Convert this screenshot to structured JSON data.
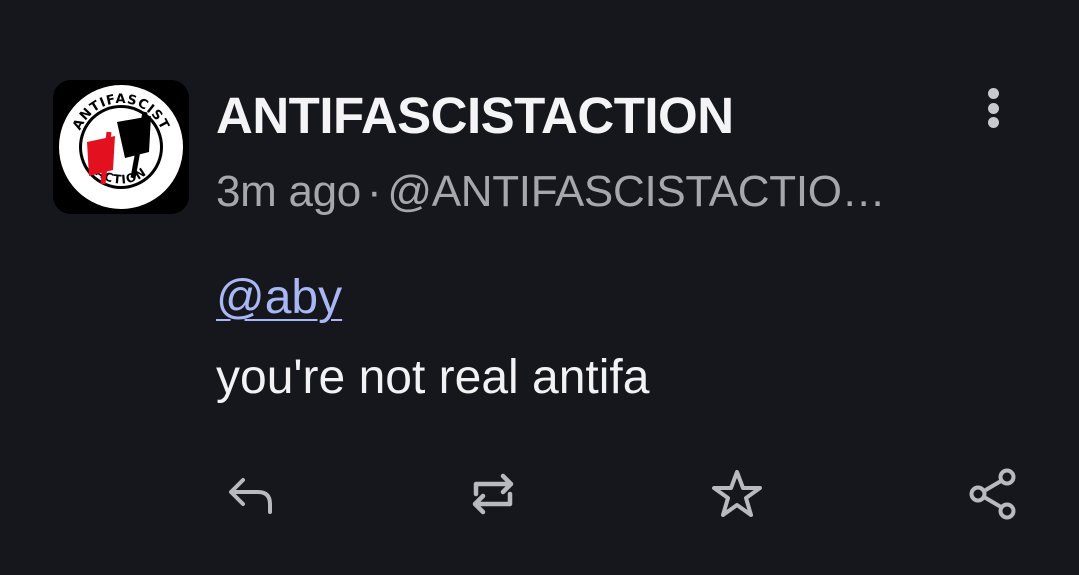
{
  "post": {
    "display_name": "ANTIFASCISTACTION",
    "time_ago": "3m ago",
    "separator": "·",
    "handle": "@ANTIFASCISTACTIO…",
    "mention": "@aby",
    "content": "you're not real antifa"
  },
  "avatar": {
    "ring_text_top": "ANTIFASCIST",
    "ring_text_bottom": "ACTION",
    "flag_colors": {
      "black": "#000000",
      "red": "#e3101f"
    }
  },
  "actions": {
    "reply_icon": "reply-icon",
    "boost_icon": "boost-icon",
    "favourite_icon": "star-icon",
    "share_icon": "share-icon",
    "more_icon": "more-vertical-icon"
  },
  "colors": {
    "background": "#16161d",
    "text_primary": "#f4f4f6",
    "text_secondary": "#a6a6ad",
    "link": "#a9b7f5",
    "icon": "#b9b9c0"
  }
}
